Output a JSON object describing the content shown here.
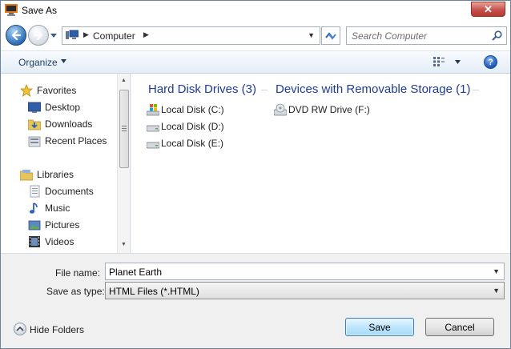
{
  "window": {
    "title": "Save As",
    "close_label": "✕"
  },
  "address_bar": {
    "location": "Computer",
    "search_placeholder": "Search Computer"
  },
  "toolbar": {
    "organize_label": "Organize",
    "help_label": "?"
  },
  "nav_pane": {
    "items": [
      {
        "label": "Favorites",
        "icon": "star-icon"
      },
      {
        "label": "Desktop",
        "icon": "desktop-icon"
      },
      {
        "label": "Downloads",
        "icon": "downloads-folder-icon"
      },
      {
        "label": "Recent Places",
        "icon": "recent-places-icon"
      },
      {
        "label": "Libraries",
        "icon": "libraries-icon"
      },
      {
        "label": "Documents",
        "icon": "documents-icon"
      },
      {
        "label": "Music",
        "icon": "music-icon"
      },
      {
        "label": "Pictures",
        "icon": "pictures-icon"
      },
      {
        "label": "Videos",
        "icon": "videos-icon"
      }
    ]
  },
  "content": {
    "groups": [
      {
        "title": "Hard Disk Drives (3)",
        "items": [
          {
            "label": "Local Disk (C:)",
            "icon": "system-drive-icon"
          },
          {
            "label": "Local Disk (D:)",
            "icon": "hard-drive-icon"
          },
          {
            "label": "Local Disk (E:)",
            "icon": "hard-drive-icon"
          }
        ]
      },
      {
        "title": "Devices with Removable Storage (1)",
        "items": [
          {
            "label": "DVD RW Drive (F:)",
            "icon": "dvd-drive-icon"
          }
        ]
      }
    ]
  },
  "form": {
    "file_name_label": "File name:",
    "file_name_value": "Planet Earth",
    "save_type_label": "Save as type:",
    "save_type_value": "HTML Files (*.HTML)"
  },
  "footer": {
    "hide_folders_label": "Hide Folders",
    "save_label": "Save",
    "cancel_label": "Cancel"
  },
  "colors": {
    "accent": "#1e3c96",
    "title_bar": "#ffffff",
    "dialog_bg": "#f0f0f0",
    "close_button": "#c75050"
  }
}
